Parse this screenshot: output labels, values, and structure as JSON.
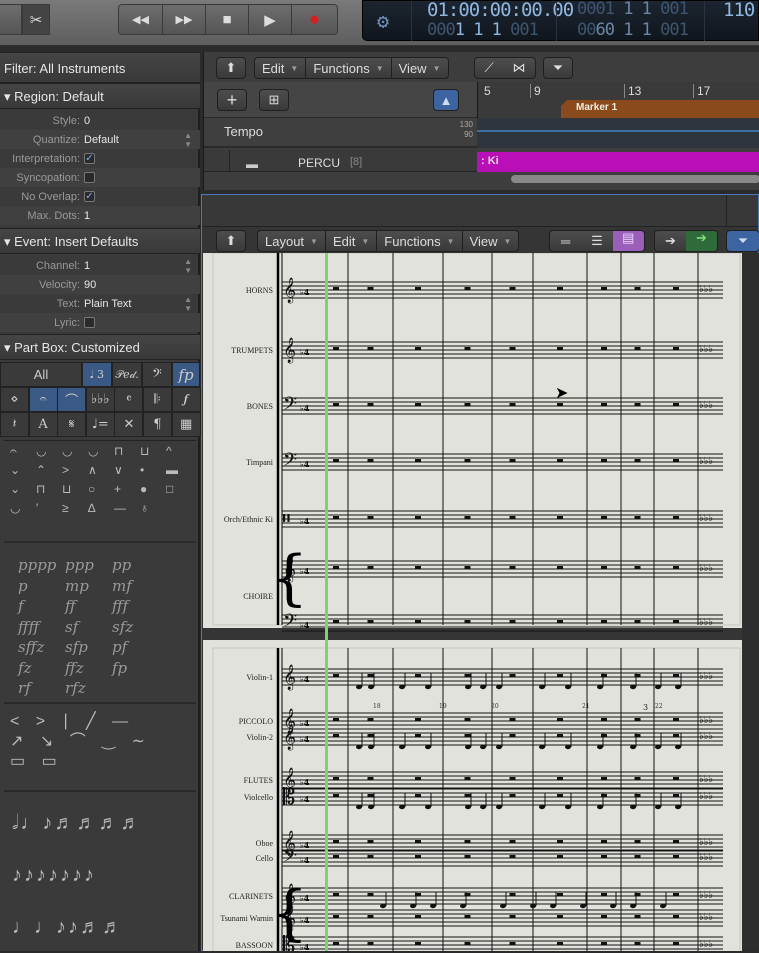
{
  "transport": {
    "rewind": "◀◀",
    "forward": "▶▶",
    "stop": "■",
    "play": "▶",
    "record": "●"
  },
  "lcd": {
    "time": "01:00:00:00.00",
    "bars_dim": "000",
    "bars": "1  1  1",
    "ticks": "001",
    "pos2_dim": "0001",
    "pos2": "1  1",
    "pos2_ticks": "001",
    "pos3_dim": "00",
    "pos3": "60  1  1",
    "pos3_ticks": "001",
    "tempo": "110.0"
  },
  "inspector": {
    "filter": "Filter: All Instruments",
    "region_header": "Region:  Default",
    "region_rows": [
      {
        "label": "Style:",
        "value": "0"
      },
      {
        "label": "Quantize:",
        "value": "Default"
      },
      {
        "label": "Interpretation:",
        "checked": true
      },
      {
        "label": "Syncopation:",
        "checked": false
      },
      {
        "label": "No Overlap:",
        "checked": true
      },
      {
        "label": "Max. Dots:",
        "value": "1"
      }
    ],
    "event_header": "Event:  Insert Defaults",
    "event_rows": [
      {
        "label": "Channel:",
        "value": "1"
      },
      {
        "label": "Velocity:",
        "value": "90"
      },
      {
        "label": "Text:",
        "value": "Plain Text"
      },
      {
        "label": "Lyric:",
        "checked": false
      }
    ],
    "partbox_header": "Part Box:  Customized",
    "partbox_all": "All",
    "partbox_tabs": [
      "𝅘𝅥 3",
      "𝒫𝑒𝒹.",
      "𝄢",
      "fp"
    ],
    "dynamics": [
      "pppp",
      "ppp",
      "pp",
      "p",
      "mp",
      "mf",
      "f",
      "ff",
      "fff",
      "ffff",
      "sf",
      "sfz",
      "sffz",
      "sfp",
      "pf",
      "fz",
      "ffz",
      "fp",
      "rf",
      "rfz"
    ]
  },
  "tracks": {
    "menus": [
      "Edit",
      "Functions",
      "View"
    ],
    "ruler": [
      "5",
      "9",
      "13",
      "17"
    ],
    "marker": "Marker 1",
    "tempo_label": "Tempo",
    "tempo_hi": "130",
    "tempo_lo": "90",
    "track_name": "PERCU",
    "track_num": "[8]",
    "region_label": ": Ki",
    "region_color": "#b80fb8",
    "marker_color": "#8a4a1c"
  },
  "score": {
    "menus": [
      "Layout",
      "Edit",
      "Functions",
      "View"
    ],
    "page1": [
      "HORNS",
      "TRUMPETS",
      "BONES",
      "Timpani",
      "Orch/Ethnic Ki",
      "CHOIRE"
    ],
    "page2": [
      "Violin-1",
      "PICCOLO",
      "Violin-2",
      "FLUTES",
      "Violcello",
      "Oboe",
      "Cello",
      "CLARINETS",
      "Tsunami Warnin",
      "BASSOON"
    ],
    "bar_numbers": [
      "18",
      "19",
      "20",
      "21",
      "22"
    ],
    "tuplet": "3",
    "playhead_color": "#7fd36f"
  }
}
